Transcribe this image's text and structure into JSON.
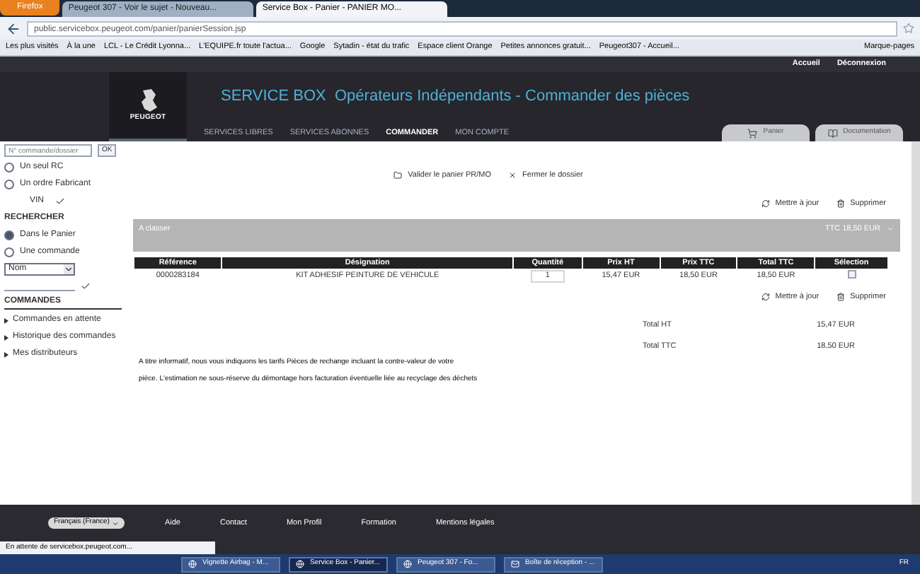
{
  "browser": {
    "menu_button": "Firefox",
    "tabs": [
      {
        "label": "Peugeot 307 - Voir le sujet - Nouveau...",
        "selected": false
      },
      {
        "label": "Service Box - Panier - PANIER MO...",
        "selected": true
      }
    ],
    "url": "public.servicebox.peugeot.com/panier/panierSession.jsp",
    "bookmarks": [
      "Les plus visités",
      "À la une",
      "LCL - Le Crédit Lyonna...",
      "L'EQUIPE.fr toute l'actua...",
      "Google",
      "Sytadin - état du trafic",
      "Espace client Orange",
      "Petites annonces gratuit...",
      "Peugeot307 - Accueil..."
    ],
    "bookmarks_menu": "Marque-pages"
  },
  "site": {
    "top_links": [
      "Accueil",
      "Déconnexion"
    ],
    "logo_text": "PEUGEOT",
    "title": "SERVICE BOX  Opérateurs Indépendants - Commander des pièces",
    "nav": [
      {
        "label": "SERVICES LIBRES",
        "selected": false
      },
      {
        "label": "SERVICES ABONNES",
        "selected": false
      },
      {
        "label": "COMMANDER",
        "selected": true
      },
      {
        "label": "MON COMPTE",
        "selected": false
      }
    ],
    "right_tabs": [
      "Panier",
      "Documentation"
    ]
  },
  "sidebar": {
    "search": {
      "placeholder": "N° commande/dossier",
      "button": "OK"
    },
    "options": [
      {
        "label": "Un seul RC",
        "selected": false
      },
      {
        "label": "Un ordre Fabricant",
        "selected": false
      }
    ],
    "vin_label": "VIN",
    "search_heading": "RECHERCHER",
    "search_options": [
      {
        "label": "Dans le Panier",
        "selected": true
      },
      {
        "label": "Une commande",
        "selected": false
      }
    ],
    "select_value": "Nom",
    "orders_heading": "COMMANDES",
    "links": [
      "Commandes en attente",
      "Historique des commandes",
      "Mes distributeurs"
    ]
  },
  "main": {
    "actions": [
      "Valider le panier PR/MO",
      "Fermer le dossier"
    ],
    "top_tools": [
      "Mettre à jour",
      "Supprimer"
    ],
    "group": {
      "title": "A classer",
      "total": "TTC 18,50 EUR"
    },
    "table": {
      "columns": [
        "Référence",
        "Désignation",
        "Quantité",
        "Prix HT",
        "Prix TTC",
        "Total TTC",
        "Sélection"
      ],
      "rows": [
        {
          "reference": "0000283184",
          "designation": "KIT ADHESIF PEINTURE DE VEHICULE",
          "quantity": "1",
          "price_ht": "15,47 EUR",
          "price_ttc": "18,50 EUR",
          "total_ttc": "18,50 EUR",
          "selected": false
        }
      ]
    },
    "bottom_tools": [
      "Mettre à jour",
      "Supprimer"
    ],
    "totals": [
      {
        "label": "Total HT",
        "value": "15,47 EUR"
      },
      {
        "label": "Total TTC",
        "value": "18,50 EUR"
      }
    ],
    "notice": [
      "A titre informatif, nous vous indiquons les tarifs Pièces de rechange incluant la contre-valeur de votre",
      "pièce. L'estimation ne sous-réserve du démontage hors facturation éventuelle liée au recyclage des déchets"
    ]
  },
  "footer": {
    "language": "Français (France)",
    "links": [
      "Aide",
      "Contact",
      "Mon Profil",
      "Formation",
      "Mentions légales"
    ]
  },
  "status": "En attente de servicebox.peugeot.com...",
  "taskbar": {
    "items": [
      {
        "label": "Vignette Airbag - M...",
        "selected": false
      },
      {
        "label": "Service Box - Panier...",
        "selected": true
      },
      {
        "label": "Peugeot 307 - Fo...",
        "selected": false
      },
      {
        "label": "Boîte de réception - ...",
        "selected": false
      }
    ],
    "tray": "FR"
  }
}
